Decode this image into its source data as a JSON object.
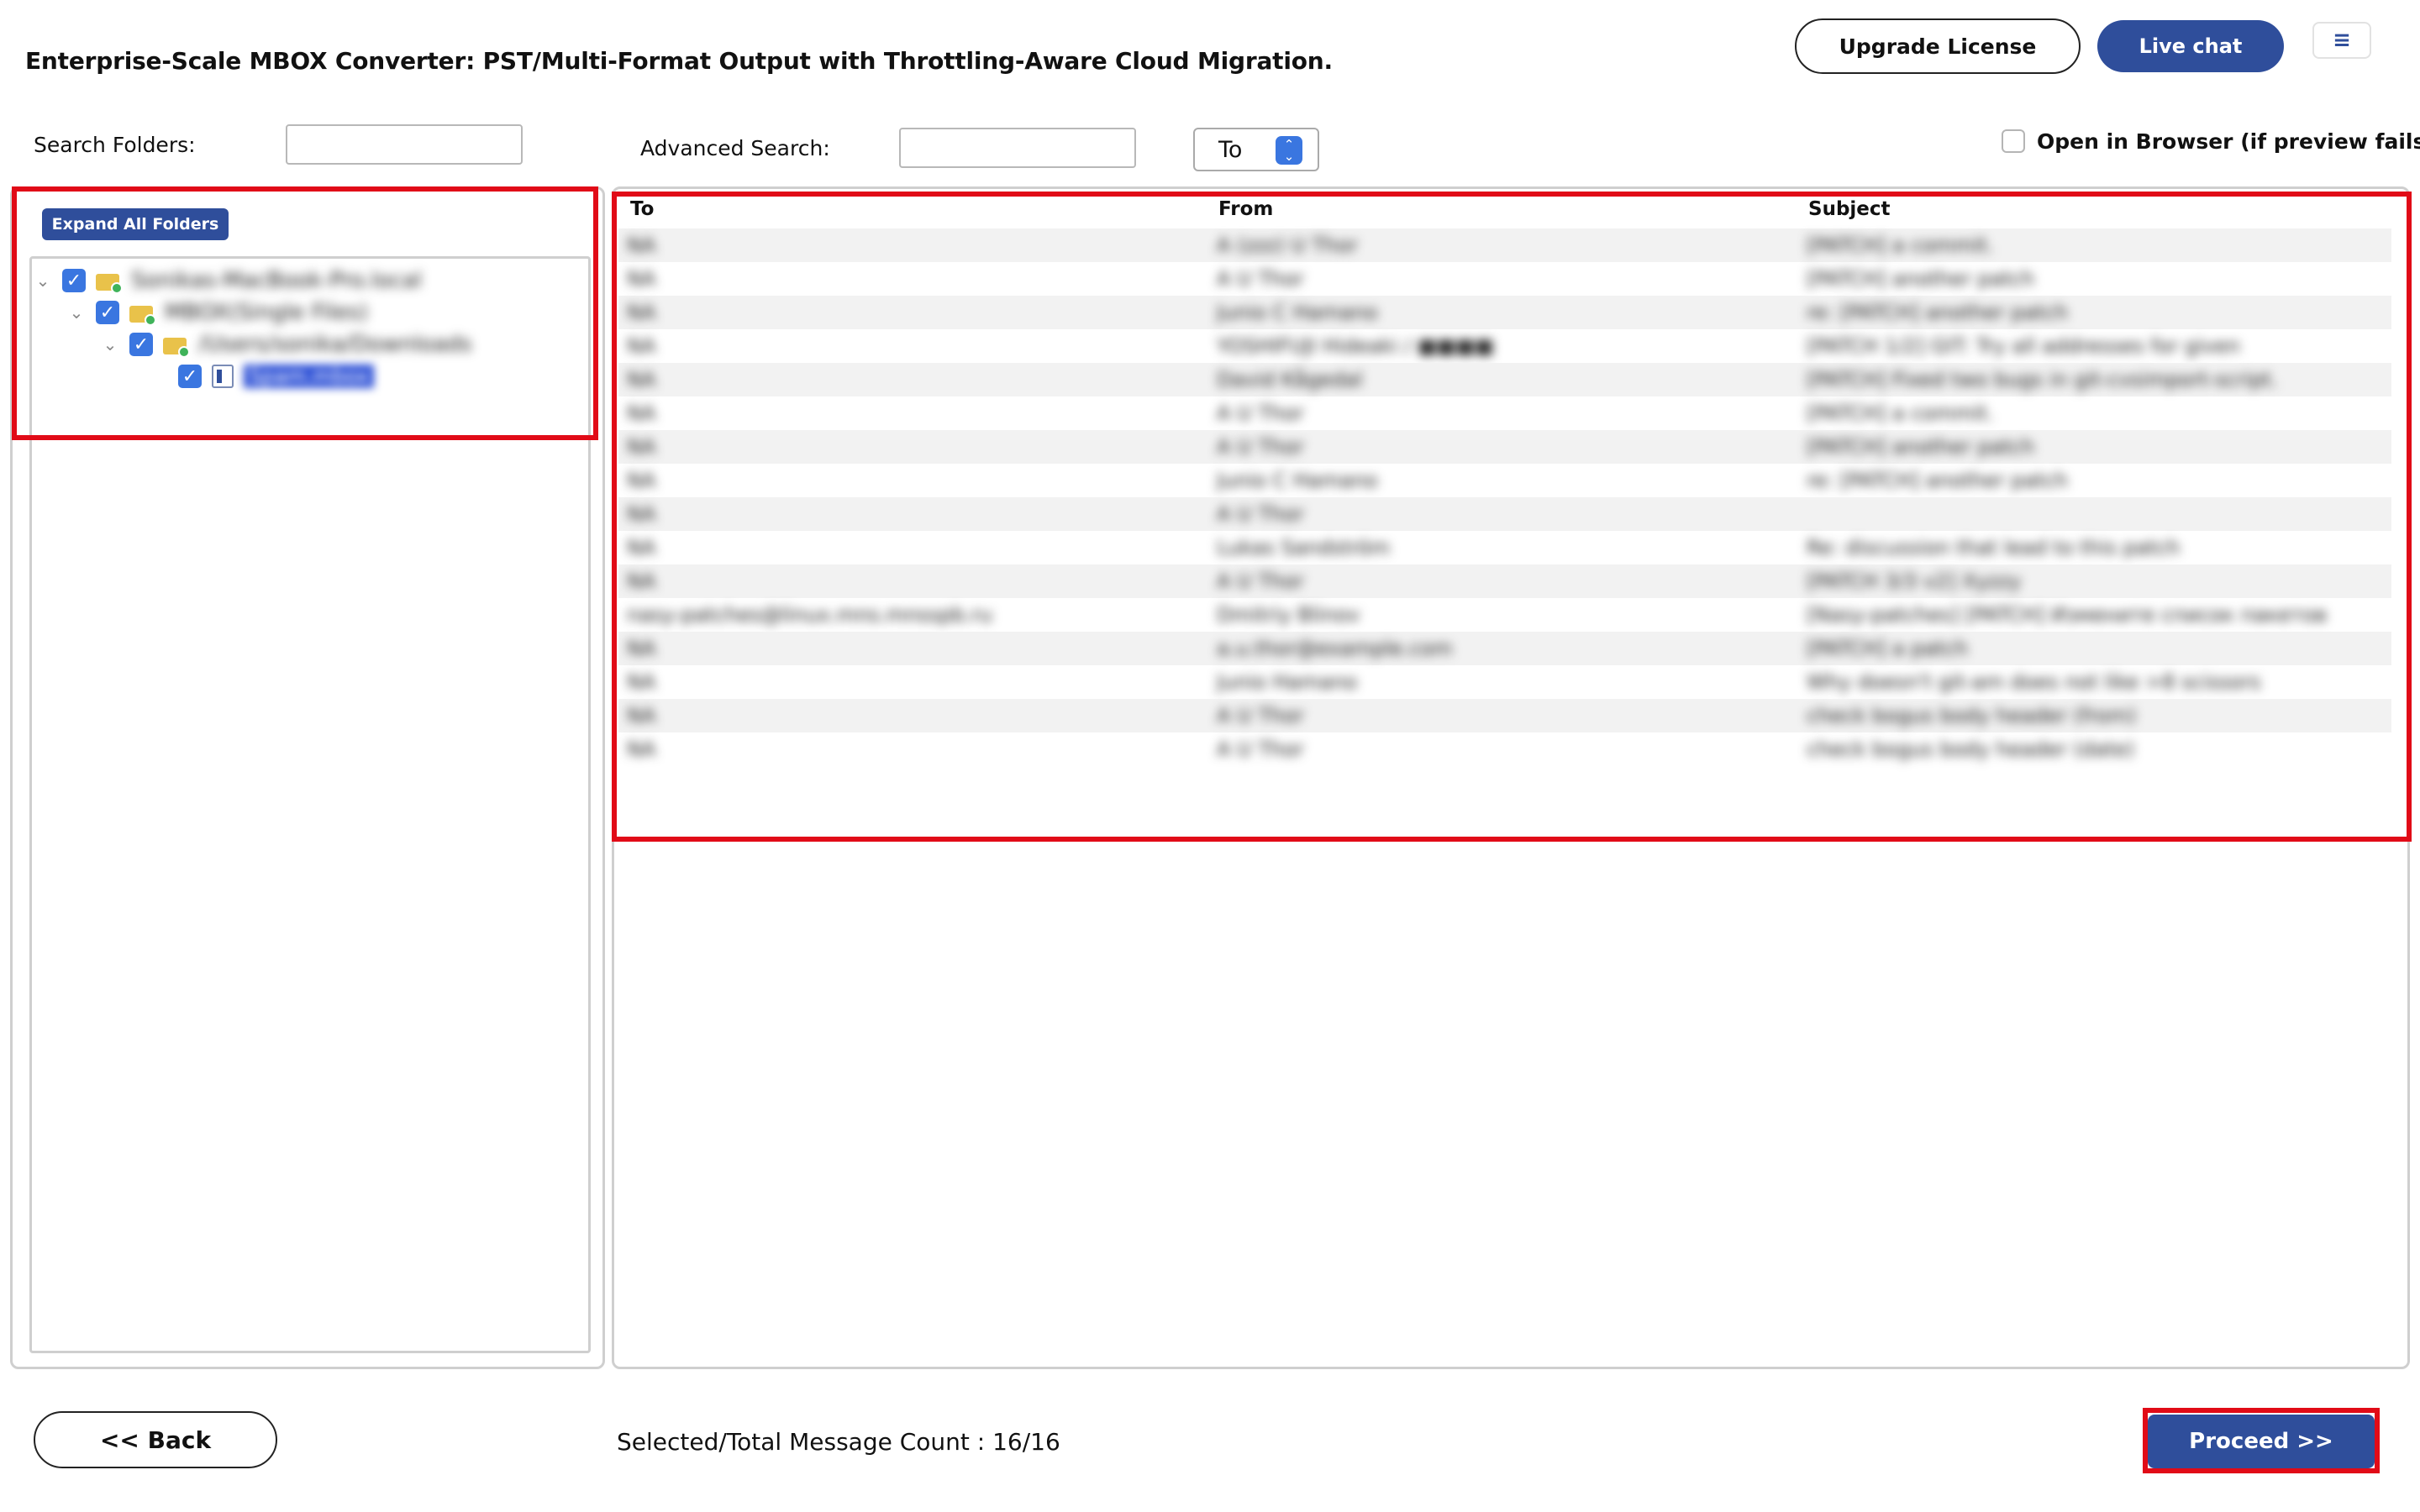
{
  "header": {
    "title": "Enterprise-Scale MBOX Converter: PST/Multi-Format Output with Throttling-Aware Cloud Migration.",
    "upgrade_label": "Upgrade License",
    "livechat_label": "Live chat",
    "menu_glyph": "≡"
  },
  "search": {
    "folders_label": "Search Folders:",
    "folders_value": "",
    "advanced_label": "Advanced Search:",
    "advanced_value": "",
    "field_selected": "To",
    "open_browser_label": "Open in Browser (if preview fails)"
  },
  "tree": {
    "expand_label": "Expand All Folders",
    "nodes": [
      {
        "label": "Sonikas-MacBook-Pro.local",
        "checked": true,
        "icon": "folder-icon"
      },
      {
        "label": "MBOX(Single Files)",
        "checked": true,
        "icon": "folder-icon"
      },
      {
        "label": "/Users/sonika/Downloads",
        "checked": true,
        "icon": "folder-icon"
      },
      {
        "label": "Spam.mbox",
        "checked": true,
        "icon": "mbox-file-icon",
        "selected": true
      }
    ]
  },
  "grid": {
    "columns": [
      "To",
      "From",
      "Subject"
    ],
    "rows": [
      {
        "to": "NA",
        "from": "A (zzz) U Thor",
        "subject": "[PATCH] a commit."
      },
      {
        "to": "NA",
        "from": "A U Thor",
        "subject": "[PATCH] another patch"
      },
      {
        "to": "NA",
        "from": "Junio C Hamano",
        "subject": "re: [PATCH] another patch"
      },
      {
        "to": "NA",
        "from": "YOSHIFUJI Hideaki / ■■■■",
        "subject": "[PATCH 1/2] GIT: Try all addresses for given"
      },
      {
        "to": "NA",
        "from": "David Kågedal",
        "subject": "[PATCH] Fixed two bugs in git-cvsimport-script."
      },
      {
        "to": "NA",
        "from": "A U Thor",
        "subject": "[PATCH] a commit."
      },
      {
        "to": "NA",
        "from": "A U Thor",
        "subject": "[PATCH] another patch"
      },
      {
        "to": "NA",
        "from": "Junio C Hamano",
        "subject": "re: [PATCH] another patch"
      },
      {
        "to": "NA",
        "from": "A U Thor",
        "subject": ""
      },
      {
        "to": "NA",
        "from": "Lukas Sandström",
        "subject": "Re: discussion that lead to this patch"
      },
      {
        "to": "NA",
        "from": "A U Thor",
        "subject": "[PATCH 3/3 v2] Xyzzy"
      },
      {
        "to": "nasy-patches@linux.mns.mnsspb.ru",
        "from": "Dmitriy Blinov",
        "subject": "[Nasy-patches] [PATCH] Измените список пакетов"
      },
      {
        "to": "NA",
        "from": "a.u.thor@example.com",
        "subject": "[PATCH] a patch"
      },
      {
        "to": "NA",
        "from": "Junio Hamano",
        "subject": "Why doesn't git-am does not like >8 scissors"
      },
      {
        "to": "NA",
        "from": "A U Thor",
        "subject": "check bogus body header (from)"
      },
      {
        "to": "NA",
        "from": "A U Thor",
        "subject": "check bogus body header (date)"
      }
    ]
  },
  "footer": {
    "back_label": "<< Back",
    "count_label": "Selected/Total Message Count : 16/16",
    "proceed_label": "Proceed >>"
  },
  "colors": {
    "accent": "#2f4e9b",
    "checkbox": "#3a76e0",
    "highlight": "#e10b17"
  }
}
